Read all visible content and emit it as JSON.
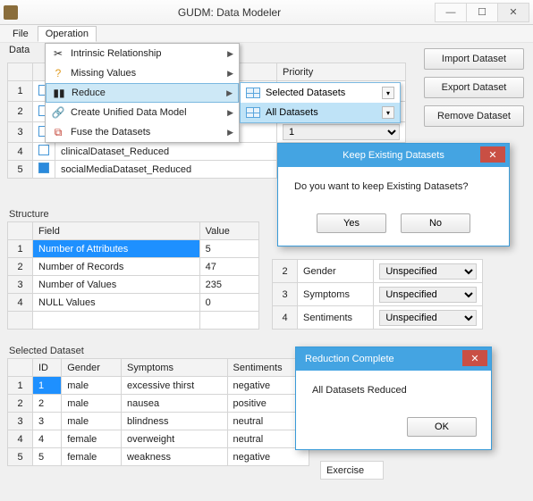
{
  "window": {
    "title": "GUDM: Data Modeler"
  },
  "menubar": {
    "file": "File",
    "operation": "Operation",
    "data": "Data"
  },
  "op_menu": {
    "items": [
      {
        "label": "Intrinsic Relationship"
      },
      {
        "label": "Missing Values"
      },
      {
        "label": "Reduce"
      },
      {
        "label": "Create Unified Data Model"
      },
      {
        "label": "Fuse the Datasets"
      }
    ]
  },
  "reduce_submenu": {
    "items": [
      {
        "label": "Selected Datasets"
      },
      {
        "label": "All Datasets"
      }
    ]
  },
  "side_buttons": {
    "import": "Import Dataset",
    "export": "Export Dataset",
    "remove": "Remove Dataset"
  },
  "datasets": {
    "headers": {
      "priority": "Priority"
    },
    "rows": [
      {
        "n": "1",
        "name": "",
        "priority": ""
      },
      {
        "n": "2",
        "name": "",
        "priority": ""
      },
      {
        "n": "3",
        "name": "",
        "priority": "1"
      },
      {
        "n": "4",
        "name": "clinicalDataset_Reduced",
        "priority": ""
      },
      {
        "n": "5",
        "name": "socialMediaDataset_Reduced",
        "priority": ""
      }
    ]
  },
  "structure": {
    "label": "Structure",
    "left": {
      "headers": {
        "field": "Field",
        "value": "Value"
      },
      "rows": [
        {
          "n": "1",
          "field": "Number of Attributes",
          "value": "5"
        },
        {
          "n": "2",
          "field": "Number of Records",
          "value": "47"
        },
        {
          "n": "3",
          "field": "Number of Values",
          "value": "235"
        },
        {
          "n": "4",
          "field": "NULL Values",
          "value": "0"
        }
      ]
    },
    "right": {
      "rows": [
        {
          "n": "2",
          "name": "Gender",
          "val": "Unspecified"
        },
        {
          "n": "3",
          "name": "Symptoms",
          "val": "Unspecified"
        },
        {
          "n": "4",
          "name": "Sentiments",
          "val": "Unspecified"
        }
      ]
    }
  },
  "selected": {
    "label": "Selected Dataset",
    "headers": {
      "id": "ID",
      "gender": "Gender",
      "symptoms": "Symptoms",
      "sentiments": "Sentiments"
    },
    "rows": [
      {
        "n": "1",
        "id": "1",
        "gender": "male",
        "symptoms": "excessive thirst",
        "sentiments": "negative"
      },
      {
        "n": "2",
        "id": "2",
        "gender": "male",
        "symptoms": "nausea",
        "sentiments": "positive"
      },
      {
        "n": "3",
        "id": "3",
        "gender": "male",
        "symptoms": "blindness",
        "sentiments": "neutral"
      },
      {
        "n": "4",
        "id": "4",
        "gender": "female",
        "symptoms": "overweight",
        "sentiments": "neutral"
      },
      {
        "n": "5",
        "id": "5",
        "gender": "female",
        "symptoms": "weakness",
        "sentiments": "negative"
      }
    ]
  },
  "extra_cell": "Exercise",
  "dialog_keep": {
    "title": "Keep Existing Datasets",
    "msg": "Do you want to keep Existing Datasets?",
    "yes": "Yes",
    "no": "No"
  },
  "dialog_done": {
    "title": "Reduction Complete",
    "msg": "All Datasets Reduced",
    "ok": "OK"
  }
}
